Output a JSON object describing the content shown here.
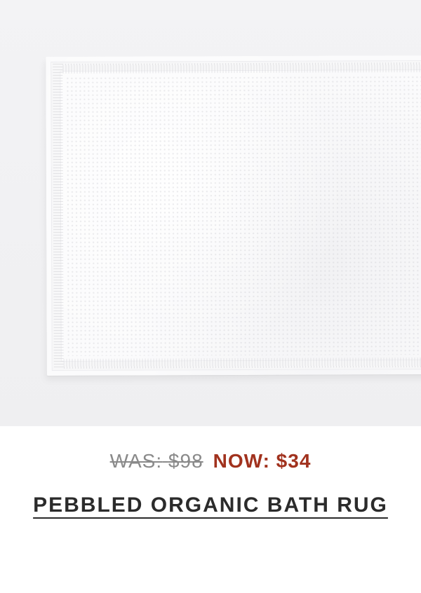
{
  "product": {
    "image_alt": "White pebbled organic cotton bath rug",
    "was_label": "WAS:",
    "was_price": "$98",
    "now_label": "NOW:",
    "now_price": "$34",
    "title": "PEBBLED ORGANIC BATH RUG"
  },
  "colors": {
    "sale_price": "#a1321e",
    "was_price": "#8a8a8a",
    "title": "#2b2b2b",
    "image_background": "#f1f1f3"
  }
}
